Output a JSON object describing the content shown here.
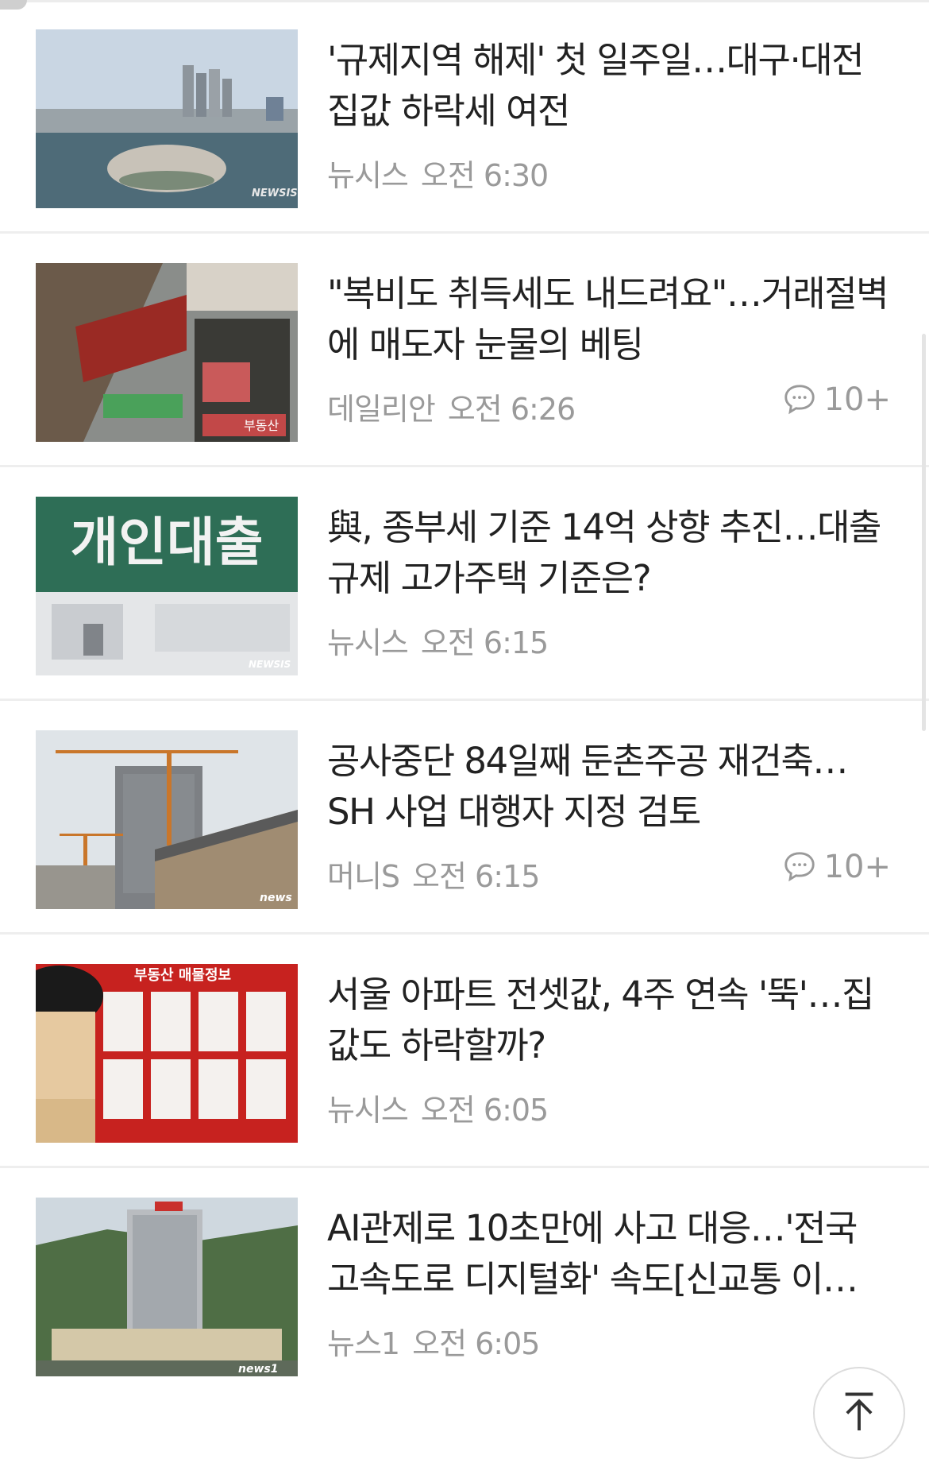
{
  "articles": [
    {
      "title": "'규제지역 해제' 첫 일주일…대구·대전 집값 하락세 여전",
      "source": "뉴시스",
      "time": "오전 6:30",
      "comments": null,
      "thumb_watermark": "NEWSIS"
    },
    {
      "title": "\"복비도 취득세도 내드려요\"…거래절벽에 매도자 눈물의 베팅",
      "source": "데일리안",
      "time": "오전 6:26",
      "comments": "10+",
      "thumb_text": "부동산"
    },
    {
      "title": "與, 종부세 기준 14억 상향 추진…대출규제 고가주택 기준은?",
      "source": "뉴시스",
      "time": "오전 6:15",
      "comments": null,
      "thumb_text": "개인대출",
      "thumb_watermark": "NEWSIS"
    },
    {
      "title": "공사중단 84일째 둔촌주공 재건축… SH 사업 대행자 지정 검토",
      "source": "머니S",
      "time": "오전 6:15",
      "comments": "10+",
      "thumb_watermark": "news"
    },
    {
      "title": "서울 아파트 전셋값, 4주 연속 '뚝'…집값도 하락할까?",
      "source": "뉴시스",
      "time": "오전 6:05",
      "comments": null,
      "thumb_text": "부동산 매물정보"
    },
    {
      "title": "AI관제로 10초만에 사고 대응…'전국 고속도로 디지털화' 속도[신교통 이…",
      "source": "뉴스1",
      "time": "오전 6:05",
      "comments": null,
      "thumb_watermark": "news1"
    }
  ],
  "icons": {
    "comment": "speech-bubble-icon",
    "top": "arrow-up-to-top-icon"
  }
}
